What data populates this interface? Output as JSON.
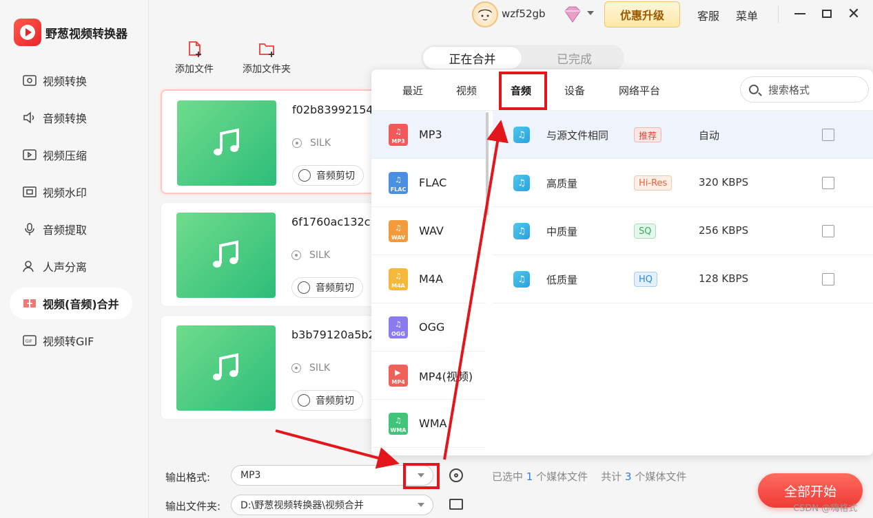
{
  "app": {
    "title": "野葱视频转换器"
  },
  "sidebar": {
    "items": [
      {
        "label": "视频转换",
        "icon": "video-convert-icon"
      },
      {
        "label": "音频转换",
        "icon": "audio-convert-icon"
      },
      {
        "label": "视频压缩",
        "icon": "video-compress-icon"
      },
      {
        "label": "视频水印",
        "icon": "watermark-icon"
      },
      {
        "label": "音频提取",
        "icon": "microphone-icon"
      },
      {
        "label": "人声分离",
        "icon": "voice-separate-icon"
      },
      {
        "label": "视频(音频)合并",
        "icon": "merge-icon"
      },
      {
        "label": "视频转GIF",
        "icon": "gif-icon"
      }
    ],
    "active_index": 6
  },
  "header": {
    "username": "wzf52gb",
    "upgrade_label": "优惠升级",
    "support_label": "客服",
    "menu_label": "菜单"
  },
  "toolbar": {
    "add_file": "添加文件",
    "add_folder": "添加文件夹"
  },
  "tabs": {
    "merging": "正在合并",
    "completed": "已完成"
  },
  "files": [
    {
      "name": "f02b83992154",
      "format": "SILK",
      "clip_label": "音频剪切"
    },
    {
      "name": "6f1760ac132c",
      "format": "SILK",
      "clip_label": "音频剪切"
    },
    {
      "name": "b3b79120a5b2",
      "format": "SILK",
      "clip_label": "音频剪切"
    }
  ],
  "format_panel": {
    "tabs": [
      "最近",
      "视频",
      "音频",
      "设备",
      "网络平台"
    ],
    "active_tab": "音频",
    "search_placeholder": "搜索格式",
    "formats": [
      {
        "name": "MP3",
        "tag": "MP3",
        "color": "#f25a5a"
      },
      {
        "name": "FLAC",
        "tag": "FLAC",
        "color": "#4a90e2"
      },
      {
        "name": "WAV",
        "tag": "WAV",
        "color": "#f39a3c"
      },
      {
        "name": "M4A",
        "tag": "M4A",
        "color": "#f5b83a"
      },
      {
        "name": "OGG",
        "tag": "OGG",
        "color": "#8a7cf0"
      },
      {
        "name": "MP4(视频)",
        "tag": "MP4",
        "color": "#f0615a"
      },
      {
        "name": "WMA",
        "tag": "WMA",
        "color": "#3fc47a"
      }
    ],
    "qualities": [
      {
        "name": "与源文件相同",
        "badge": "推荐",
        "rate": "自动",
        "badge_color": "#e0453c",
        "badge_bg": "#fde8e6"
      },
      {
        "name": "高质量",
        "badge": "Hi-Res",
        "rate": "320 KBPS",
        "badge_color": "#e8633a",
        "badge_bg": "#fdeee6"
      },
      {
        "name": "中质量",
        "badge": "SQ",
        "rate": "256 KBPS",
        "badge_color": "#2fae5e",
        "badge_bg": "#e4f7ea"
      },
      {
        "name": "低质量",
        "badge": "HQ",
        "rate": "128 KBPS",
        "badge_color": "#2f86d6",
        "badge_bg": "#e4f0fb"
      }
    ]
  },
  "bottom": {
    "output_format_label": "输出格式:",
    "output_format_value": "MP3",
    "output_folder_label": "输出文件夹:",
    "output_folder_value": "D:\\野葱视频转换器\\视频合并",
    "stats_selected_prefix": "已选中",
    "stats_selected_count": "1",
    "stats_selected_suffix": "个媒体文件",
    "stats_total_prefix": "共计",
    "stats_total_count": "3",
    "stats_total_suffix": "个媒体文件",
    "start_label": "全部开始"
  },
  "watermark": "CSDN @嗨格式",
  "colors": {
    "accent": "#ef3b36",
    "annotation": "#e3161c"
  }
}
